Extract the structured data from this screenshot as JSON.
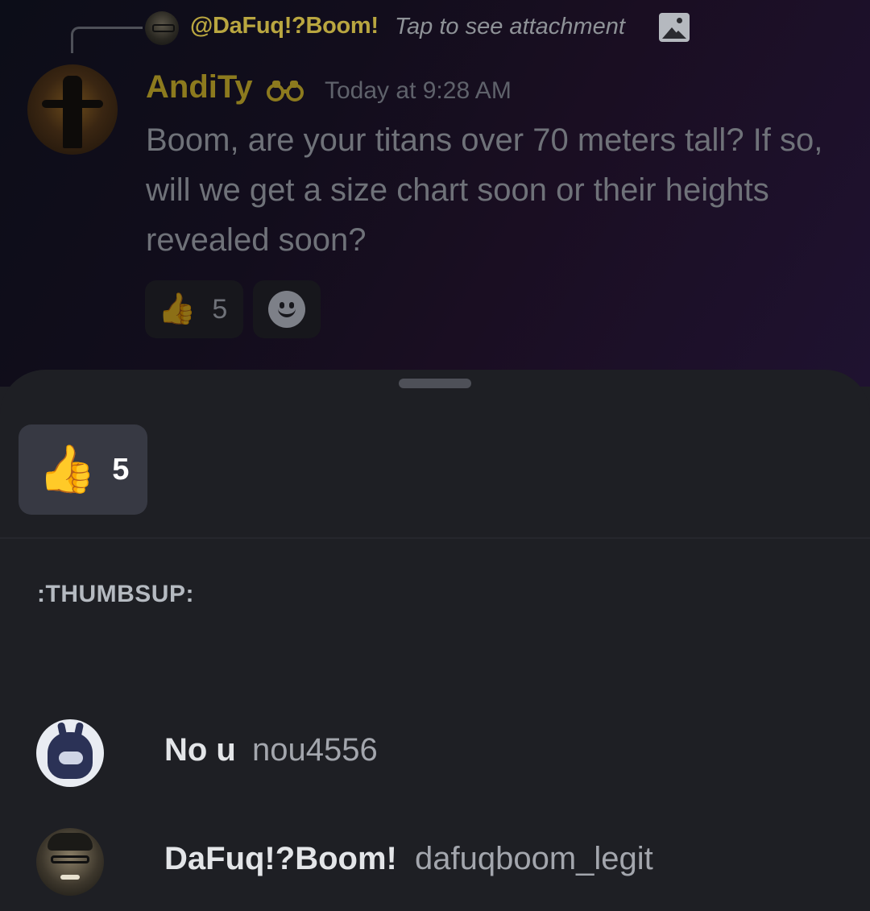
{
  "background_message": {
    "reply": {
      "author": "@DaFuq!?Boom!",
      "hint": "Tap to see attachment",
      "attachment_icon": "image-icon"
    },
    "author": {
      "name": "AndiTy",
      "badge_icon": "binoculars-icon",
      "name_color": "#8c7a1e"
    },
    "timestamp": "Today at 9:28 AM",
    "body": "Boom, are your titans over 70 meters tall? If so, will we get a size chart soon or their heights revealed soon?",
    "reactions": [
      {
        "emoji": "👍",
        "count": "5"
      }
    ],
    "add_reaction_icon": "smiley-icon"
  },
  "sheet": {
    "selected_reaction": {
      "emoji": "👍",
      "count": "5"
    },
    "emoji_heading": ":THUMBSUP:",
    "users": [
      {
        "display_name": "No u",
        "username": "nou4556"
      },
      {
        "display_name": "DaFuq!?Boom!",
        "username": "dafuqboom_legit"
      }
    ]
  },
  "colors": {
    "sheet_bg": "#1e1f24",
    "reaction_tab_bg": "#373943",
    "heading": "#b5bac1"
  }
}
